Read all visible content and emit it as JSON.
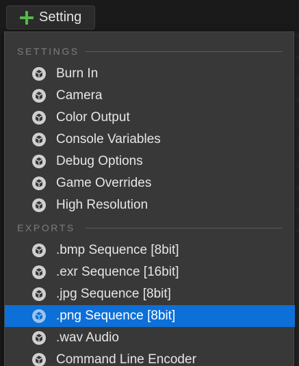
{
  "toolbar": {
    "add_button_label": "Setting",
    "add_icon": "plus-icon",
    "add_icon_color": "#55b948"
  },
  "menu": {
    "sections": [
      {
        "title": "SETTINGS",
        "items": [
          {
            "label": "Burn In",
            "icon": "cube-icon"
          },
          {
            "label": "Camera",
            "icon": "cube-icon"
          },
          {
            "label": "Color Output",
            "icon": "cube-icon"
          },
          {
            "label": "Console Variables",
            "icon": "cube-icon"
          },
          {
            "label": "Debug Options",
            "icon": "cube-icon"
          },
          {
            "label": "Game Overrides",
            "icon": "cube-icon"
          },
          {
            "label": "High Resolution",
            "icon": "cube-icon"
          }
        ]
      },
      {
        "title": "EXPORTS",
        "items": [
          {
            "label": ".bmp Sequence [8bit]",
            "icon": "cube-icon"
          },
          {
            "label": ".exr Sequence [16bit]",
            "icon": "cube-icon"
          },
          {
            "label": ".jpg Sequence [8bit]",
            "icon": "cube-icon"
          },
          {
            "label": ".png Sequence [8bit]",
            "icon": "cube-icon",
            "selected": true
          },
          {
            "label": ".wav Audio",
            "icon": "cube-icon"
          },
          {
            "label": "Command Line Encoder",
            "icon": "cube-icon"
          }
        ]
      }
    ],
    "selection_color": "#0d6fd8"
  }
}
